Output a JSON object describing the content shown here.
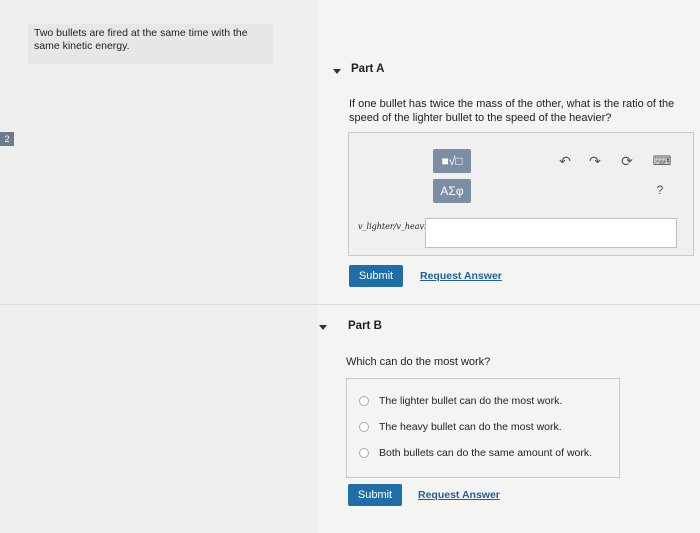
{
  "intro": {
    "text": "Two bullets are fired at the same time with the same kinetic energy."
  },
  "edge_number": "2",
  "partA": {
    "title": "Part A",
    "question": "If one bullet has twice the mass of the other, what is the ratio of the speed of the lighter bullet to the speed of the heavier?",
    "toolbar": {
      "matrix_label": "■√□",
      "greek_label": "ΑΣφ",
      "help_label": "?",
      "keyboard_label": "⌨"
    },
    "input_label": "v_lighter/v_heavier =",
    "submit_label": "Submit",
    "request_label": "Request Answer"
  },
  "partB": {
    "title": "Part B",
    "question": "Which can do the most work?",
    "options": [
      "The lighter bullet can do the most work.",
      "The heavy bullet can do the most work.",
      "Both bullets can do the same amount of work."
    ],
    "submit_label": "Submit",
    "request_label": "Request Answer"
  }
}
